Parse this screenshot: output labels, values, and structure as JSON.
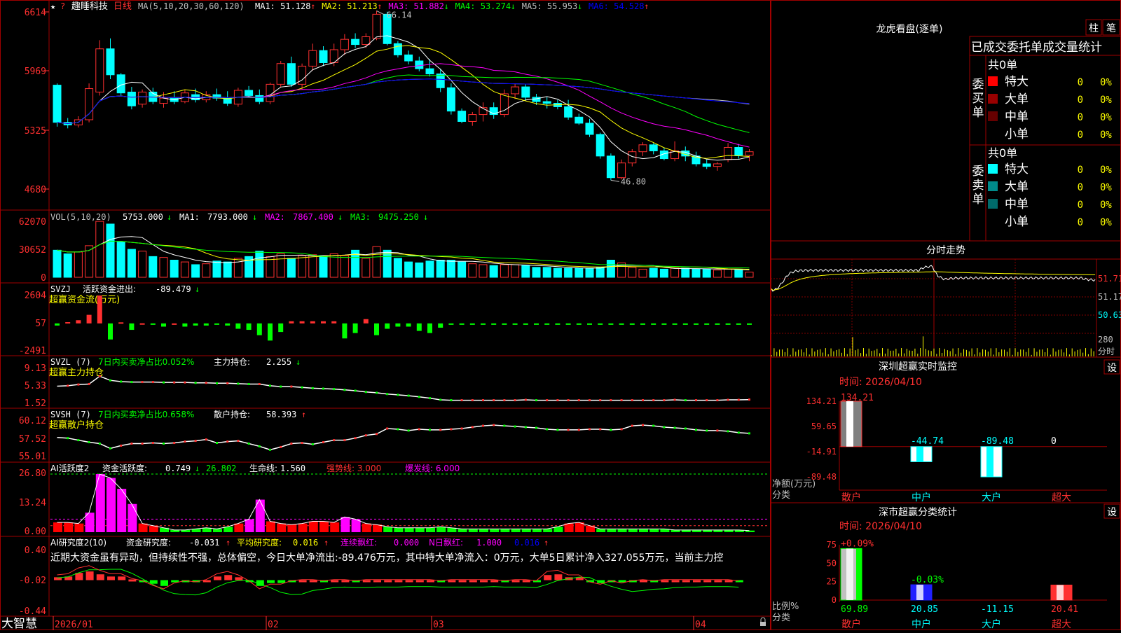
{
  "header": {
    "star": "★",
    "marker": "?",
    "stock_name": "趣睡科技",
    "period": "日线",
    "ma_def": "MA(5,10,20,30,60,120)",
    "items": [
      {
        "label": "MA1:",
        "value": "51.128",
        "arrow": "↑",
        "color": "#ffffff"
      },
      {
        "label": "MA2:",
        "value": "51.213",
        "arrow": "↑",
        "color": "#ffff00"
      },
      {
        "label": "MA3:",
        "value": "51.882",
        "arrow": "↓",
        "color": "#ff00ff"
      },
      {
        "label": "MA4:",
        "value": "53.274",
        "arrow": "↓",
        "color": "#00ff00"
      },
      {
        "label": "MA5:",
        "value": "55.953",
        "arrow": "↓",
        "color": "#c0c0c0"
      },
      {
        "label": "MA6:",
        "value": "54.528",
        "arrow": "↑",
        "color": "#0000ff"
      }
    ]
  },
  "price_axis": [
    "6614",
    "5969",
    "5325",
    "4680"
  ],
  "price_marks": {
    "high": "66.14",
    "low": "46.80"
  },
  "vol": {
    "def": "VOL(5,10,20)",
    "value": "5753.000",
    "arrow": "↓",
    "ma1_label": "MA1:",
    "ma1": "7793.000",
    "ma1_arrow": "↓",
    "ma2_label": "MA2:",
    "ma2": "7867.400",
    "ma2_arrow": "↓",
    "ma3_label": "MA3:",
    "ma3": "9475.250",
    "ma3_arrow": "↓",
    "axis": [
      "62070",
      "30652",
      "0"
    ]
  },
  "svzj": {
    "def": "SVZJ",
    "label": "活跃资金进出:",
    "value": "-89.479",
    "arrow": "↓",
    "sub": "超赢资金流(万元)",
    "axis": [
      "2604",
      "57",
      "-2491"
    ]
  },
  "svzl": {
    "def": "SVZL (7)",
    "label": "7日内买卖净占比0.052%",
    "label2": "主力持仓:",
    "value": "2.255",
    "arrow": "↓",
    "sub": "超赢主力持仓",
    "axis": [
      "9.13",
      "5.33",
      "1.52"
    ]
  },
  "svsh": {
    "def": "SVSH (7)",
    "label": "7日内买卖净占比0.658%",
    "label2": "散户持仓:",
    "value": "58.393",
    "arrow": "↑",
    "sub": "超赢散户持仓",
    "axis": [
      "60.12",
      "57.52",
      "55.01"
    ]
  },
  "ai1": {
    "def": "AI活跃度2",
    "label": "资金活跃度:",
    "value": "0.749",
    "arrow": "↓",
    "v2": "26.802",
    "label3": "生命线:",
    "v3": "1.560",
    "label4": "强势线: 3.000",
    "label5": "爆发线: 6.000",
    "axis": [
      "26.80",
      "13.24",
      "0.00"
    ]
  },
  "ai2": {
    "def": "AI研究度2(10)",
    "label": "资金研究度:",
    "value": "-0.031",
    "arrow": "↑",
    "label2": "平均研究度:",
    "v2": "0.016",
    "arrow2": "↑",
    "label3": "连续飘红:",
    "v3": "0.000",
    "label4": "N日飘红:",
    "v4": "1.000",
    "v5": "0.016",
    "arrow5": "↑",
    "comment": "近期大资金虽有异动，但持续性不强，总体偏空，今日大单净流出:-89.476万元，其中特大单净流入：0万元，大单5日累计净入327.055万元，当前主力控",
    "axis": [
      "0.40",
      "-0.02",
      "-0.44"
    ]
  },
  "date_axis": [
    "2026/01",
    "02",
    "03",
    "04"
  ],
  "brand": "大智慧",
  "lhb": {
    "title": "龙虎看盘(逐单)",
    "tab1": "柱",
    "tab2": "笔",
    "headers": [
      "已成交",
      "委托单",
      "成交量",
      "统计"
    ],
    "buy_total": "共0单",
    "sell_total": "共0单",
    "buy_side": "委买单",
    "sell_side": "委卖单",
    "buy_rows": [
      {
        "name": "特大",
        "color": "#ff0000",
        "value": "0",
        "pct": "0%"
      },
      {
        "name": "大单",
        "color": "#990000",
        "value": "0",
        "pct": "0%"
      },
      {
        "name": "中单",
        "color": "#660000",
        "value": "0",
        "pct": "0%"
      },
      {
        "name": "小单",
        "color": "",
        "value": "0",
        "pct": "0%"
      }
    ],
    "sell_rows": [
      {
        "name": "特大",
        "color": "#00ffff",
        "value": "0",
        "pct": "0%"
      },
      {
        "name": "大单",
        "color": "#008b8b",
        "value": "0",
        "pct": "0%"
      },
      {
        "name": "中单",
        "color": "#006b6b",
        "value": "0",
        "pct": "0%"
      },
      {
        "name": "小单",
        "color": "",
        "value": "0",
        "pct": "0%"
      }
    ]
  },
  "fenshi": {
    "title": "分时走势",
    "axis": [
      "51.71",
      "51.17",
      "50.63"
    ],
    "vol_axis": "280",
    "unit": "分时"
  },
  "monitor": {
    "title": "深圳超赢实时监控",
    "set": "设",
    "date": "时间: 2026/04/10",
    "axis": [
      "134.21",
      "59.65",
      "-14.91",
      "-89.48"
    ],
    "unit": "净额(万元)",
    "cat_label": "分类"
  },
  "stats": {
    "title": "深市超赢分类统计",
    "set": "设",
    "date": "时间: 2026/04/10",
    "axis": [
      "75",
      "50",
      "25",
      "0"
    ],
    "unit": "比例%",
    "cat_label": "分类"
  },
  "chart_data": [
    {
      "type": "candlestick",
      "title": "趣睡科技 日线",
      "ylim": [
        44,
        67
      ],
      "note": "approximate daily OHLC (yuan), 2026/01 - 2026/04",
      "ohlc": [
        [
          57.8,
          58.0,
          53.0,
          53.5
        ],
        [
          53.5,
          54.0,
          52.8,
          53.2
        ],
        [
          53.2,
          54.2,
          52.9,
          53.8
        ],
        [
          53.8,
          58.0,
          53.5,
          57.4
        ],
        [
          57.0,
          63.0,
          56.6,
          62.0
        ],
        [
          62.0,
          63.2,
          58.5,
          59.0
        ],
        [
          59.0,
          59.2,
          56.6,
          56.9
        ],
        [
          57.0,
          57.6,
          55.0,
          55.4
        ],
        [
          55.6,
          57.3,
          55.2,
          57.0
        ],
        [
          57.0,
          57.5,
          55.6,
          55.9
        ],
        [
          55.7,
          57.0,
          55.2,
          56.3
        ],
        [
          56.3,
          57.1,
          55.6,
          55.9
        ],
        [
          55.9,
          57.3,
          55.7,
          56.9
        ],
        [
          56.7,
          57.4,
          55.8,
          56.1
        ],
        [
          56.1,
          57.1,
          55.8,
          56.7
        ],
        [
          56.7,
          57.4,
          56.0,
          56.3
        ],
        [
          56.3,
          57.1,
          55.4,
          55.7
        ],
        [
          55.6,
          57.5,
          55.3,
          57.2
        ],
        [
          57.2,
          57.7,
          56.4,
          56.6
        ],
        [
          56.6,
          57.3,
          55.6,
          55.9
        ],
        [
          55.9,
          58.1,
          55.6,
          57.9
        ],
        [
          57.9,
          60.6,
          57.6,
          60.3
        ],
        [
          60.3,
          61.1,
          57.6,
          57.9
        ],
        [
          57.9,
          60.3,
          57.3,
          60.0
        ],
        [
          60.0,
          62.6,
          59.5,
          61.8
        ],
        [
          61.8,
          62.3,
          60.0,
          60.4
        ],
        [
          60.4,
          62.6,
          60.0,
          61.9
        ],
        [
          61.9,
          63.7,
          61.3,
          63.1
        ],
        [
          63.1,
          63.8,
          62.1,
          62.5
        ],
        [
          62.5,
          63.8,
          62.1,
          63.4
        ],
        [
          63.2,
          66.4,
          63.0,
          66.0
        ],
        [
          66.0,
          66.3,
          62.4,
          62.6
        ],
        [
          62.6,
          62.9,
          61.0,
          61.3
        ],
        [
          61.3,
          61.8,
          60.2,
          60.6
        ],
        [
          60.6,
          61.1,
          59.4,
          59.7
        ],
        [
          59.7,
          60.8,
          58.8,
          59.1
        ],
        [
          59.1,
          59.7,
          57.0,
          57.5
        ],
        [
          57.5,
          58.0,
          54.4,
          54.8
        ],
        [
          54.8,
          55.1,
          53.4,
          53.6
        ],
        [
          53.6,
          54.7,
          53.1,
          54.4
        ],
        [
          54.4,
          55.8,
          53.6,
          55.2
        ],
        [
          55.2,
          55.8,
          53.9,
          54.4
        ],
        [
          54.4,
          57.3,
          54.1,
          56.8
        ],
        [
          56.8,
          58.0,
          56.2,
          57.6
        ],
        [
          57.6,
          57.9,
          56.1,
          56.4
        ],
        [
          56.4,
          56.8,
          55.5,
          55.9
        ],
        [
          55.9,
          56.4,
          55.1,
          55.7
        ],
        [
          55.7,
          56.1,
          55.0,
          55.3
        ],
        [
          55.3,
          56.1,
          53.8,
          54.1
        ],
        [
          54.1,
          54.5,
          53.2,
          53.4
        ],
        [
          53.4,
          53.9,
          51.8,
          52.1
        ],
        [
          52.1,
          52.3,
          49.3,
          49.6
        ],
        [
          49.6,
          49.9,
          46.8,
          47.1
        ],
        [
          47.1,
          49.2,
          46.9,
          48.8
        ],
        [
          48.8,
          50.4,
          48.4,
          50.1
        ],
        [
          50.1,
          51.2,
          49.6,
          50.9
        ],
        [
          50.9,
          51.1,
          49.8,
          50.2
        ],
        [
          50.2,
          50.6,
          49.1,
          49.3
        ],
        [
          49.3,
          51.3,
          49.0,
          50.2
        ],
        [
          50.2,
          50.7,
          49.0,
          49.6
        ],
        [
          49.6,
          50.1,
          48.4,
          48.7
        ],
        [
          48.7,
          49.2,
          48.1,
          48.4
        ],
        [
          48.4,
          48.9,
          47.9,
          48.7
        ],
        [
          49.2,
          51.1,
          48.9,
          50.6
        ],
        [
          50.6,
          51.0,
          49.3,
          49.7
        ],
        [
          49.7,
          50.4,
          49.0,
          50.1
        ]
      ],
      "ma_lines": [
        "MA1",
        "MA2",
        "MA3",
        "MA4",
        "MA5",
        "MA6"
      ]
    },
    {
      "type": "bar",
      "title": "VOL(5,10,20)",
      "ylim": [
        0,
        62070
      ],
      "values": [
        30000,
        26000,
        28000,
        35000,
        62000,
        59000,
        39000,
        31000,
        29000,
        23000,
        22000,
        19000,
        17000,
        14000,
        15000,
        18000,
        17000,
        21000,
        23000,
        29000,
        23000,
        26000,
        21000,
        24000,
        25000,
        24000,
        26000,
        24000,
        30000,
        21000,
        34000,
        30000,
        21000,
        17000,
        16000,
        18000,
        19000,
        19000,
        17000,
        15000,
        14000,
        13000,
        14000,
        14000,
        13000,
        11000,
        11000,
        10000,
        10000,
        10000,
        10000,
        11000,
        19000,
        16000,
        11000,
        9000,
        10000,
        9000,
        10000,
        10000,
        9000,
        9000,
        8000,
        9000,
        9000,
        5753
      ]
    },
    {
      "type": "bar",
      "title": "SVZJ 超赢资金流(万元)",
      "ylim": [
        -2491,
        2604
      ],
      "values": [
        -200,
        120,
        300,
        800,
        2604,
        -1500,
        100,
        -600,
        10,
        -100,
        -300,
        0,
        -300,
        -200,
        -200,
        -100,
        -200,
        -500,
        -600,
        -1100,
        -1600,
        -800,
        200,
        200,
        200,
        200,
        200,
        -1400,
        -900,
        400,
        -1100,
        -500,
        -300,
        -300,
        -700,
        -900,
        -400,
        -100,
        -10,
        -10,
        -10,
        -10,
        -10,
        -10,
        -10,
        -10,
        -10,
        -10,
        -10,
        -10,
        -10,
        -10,
        -10,
        -10,
        -10,
        -10,
        -10,
        -10,
        -10,
        -10,
        -10,
        -10,
        -10,
        -10,
        -10,
        -10
      ]
    },
    {
      "type": "line",
      "title": "SVZL 主力持仓",
      "ylim": [
        1.52,
        9.13
      ],
      "values": [
        5.5,
        5.6,
        5.9,
        6.0,
        7.9,
        6.9,
        6.6,
        6.5,
        6.5,
        6.5,
        6.4,
        6.4,
        6.4,
        6.3,
        6.3,
        6.2,
        6.2,
        6.1,
        6.0,
        6.0,
        5.6,
        5.4,
        5.4,
        5.2,
        5.0,
        4.9,
        4.8,
        4.6,
        4.4,
        4.1,
        3.9,
        3.6,
        3.4,
        3.2,
        2.9,
        2.6,
        2.2,
        2.1,
        2.1,
        2.1,
        2.1,
        2.1,
        2.1,
        2.1,
        2.2,
        2.1,
        2.1,
        2.1,
        2.1,
        2.1,
        2.1,
        2.1,
        2.1,
        2.1,
        2.1,
        2.1,
        2.1,
        2.1,
        2.2,
        2.1,
        2.1,
        2.1,
        2.1,
        2.2,
        2.2,
        2.255
      ]
    },
    {
      "type": "line",
      "title": "SVSH 散户持仓",
      "ylim": [
        55.01,
        60.12
      ],
      "values": [
        57.8,
        57.7,
        57.4,
        57.1,
        56.9,
        56.2,
        56.6,
        56.9,
        56.9,
        57.0,
        56.9,
        57.0,
        57.2,
        57.3,
        57.5,
        57.0,
        57.2,
        57.3,
        56.9,
        56.5,
        56.0,
        56.4,
        56.9,
        57.0,
        56.8,
        57.1,
        57.4,
        57.4,
        57.7,
        58.1,
        58.3,
        59.1,
        59.0,
        58.8,
        59.0,
        58.9,
        58.9,
        59.0,
        59.1,
        59.3,
        59.5,
        59.6,
        59.5,
        59.4,
        59.3,
        59.2,
        59.0,
        58.9,
        58.9,
        58.9,
        59.0,
        59.0,
        58.9,
        59.0,
        59.5,
        59.6,
        59.5,
        59.3,
        59.2,
        59.1,
        58.9,
        58.8,
        58.8,
        58.7,
        58.5,
        58.393
      ]
    },
    {
      "type": "bar",
      "title": "AI活跃度2",
      "ylim": [
        0,
        26.8
      ],
      "values": [
        4.5,
        4.5,
        4.0,
        9.0,
        26.8,
        25.0,
        20.0,
        13.0,
        4.0,
        3.0,
        2.0,
        1.0,
        1.0,
        1.5,
        2.0,
        1.5,
        2.5,
        4.0,
        6.0,
        15.0,
        5.0,
        4.0,
        3.5,
        4.0,
        5.0,
        5.0,
        4.5,
        7.0,
        6.0,
        4.0,
        3.5,
        2.5,
        2.0,
        2.0,
        2.0,
        2.0,
        2.5,
        2.0,
        1.5,
        1.5,
        1.5,
        1.5,
        1.5,
        1.5,
        1.5,
        1.5,
        1.5,
        2.5,
        4.0,
        4.5,
        3.0,
        1.5,
        1.5,
        1.5,
        1.5,
        1.5,
        1.5,
        1.5,
        1.0,
        1.0,
        1.0,
        1.0,
        1.0,
        1.0,
        1.0,
        0.749
      ],
      "lines": {
        "生命线": 1.56,
        "强势线": 3.0,
        "爆发线": 6.0
      }
    },
    {
      "type": "bar",
      "title": "AI研究度2(10) 资金研究度",
      "ylim": [
        -0.44,
        0.4
      ],
      "values": [
        0.02,
        0.03,
        0.08,
        0.1,
        0.06,
        0.03,
        0.03,
        -0.01,
        -0.03,
        -0.07,
        -0.1,
        -0.05,
        -0.03,
        -0.04,
        -0.02,
        0.03,
        0.05,
        0.02,
        -0.03,
        -0.1,
        -0.06,
        -0.06,
        -0.03,
        -0.02,
        -0.02,
        -0.03,
        -0.02,
        -0.02,
        -0.03,
        -0.02,
        -0.02,
        -0.02,
        -0.02,
        -0.02,
        -0.02,
        -0.02,
        -0.03,
        -0.02,
        -0.02,
        -0.02,
        -0.02,
        -0.02,
        -0.03,
        -0.02,
        -0.02,
        -0.03,
        0.05,
        0.06,
        0.02,
        0.02,
        -0.04,
        -0.06,
        -0.03,
        -0.05,
        -0.03,
        -0.02,
        -0.03,
        -0.02,
        -0.02,
        -0.02,
        -0.02,
        -0.02,
        -0.02,
        -0.02,
        -0.031
      ]
    },
    {
      "type": "bar",
      "title": "深圳超赢实时监控",
      "ylim": [
        -89.48,
        134.21
      ],
      "categories": [
        "散户",
        "中户",
        "大户",
        "超大"
      ],
      "values": [
        134.21,
        -44.74,
        -89.48,
        0
      ],
      "value_labels": [
        "134.21",
        "-44.74",
        "-89.48",
        "0"
      ]
    },
    {
      "type": "bar",
      "title": "深市超赢分类统计",
      "ylim": [
        0,
        75
      ],
      "categories": [
        "散户",
        "中户",
        "大户",
        "超大"
      ],
      "values": [
        69.89,
        20.85,
        -11.15,
        20.41
      ],
      "top_labels": [
        "+0.09%",
        "-0.03%",
        "",
        ""
      ],
      "value_labels": [
        "69.89",
        "20.85",
        "-11.15",
        "20.41"
      ]
    }
  ]
}
